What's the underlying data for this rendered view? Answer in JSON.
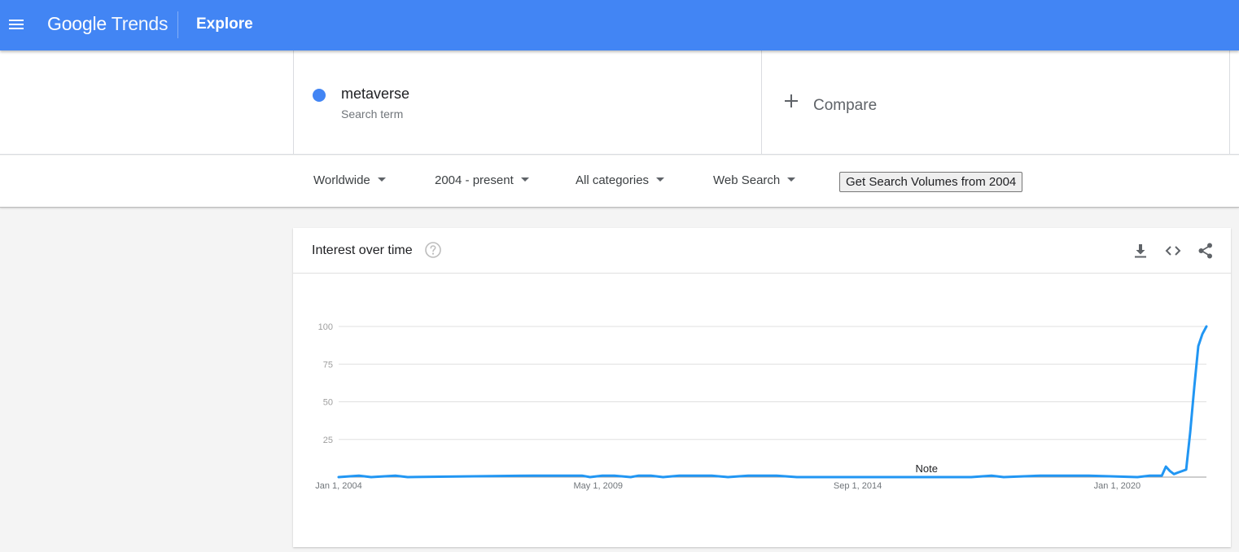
{
  "header": {
    "logo_google": "Google",
    "logo_trends": "Trends",
    "page_title": "Explore"
  },
  "search_term": {
    "name": "metaverse",
    "subtitle": "Search term",
    "color": "#4285f4"
  },
  "compare": {
    "label": "Compare"
  },
  "filters": {
    "region": "Worldwide",
    "time_range": "2004 - present",
    "category": "All categories",
    "search_type": "Web Search",
    "volume_button": "Get Search Volumes from 2004"
  },
  "card": {
    "title": "Interest over time",
    "icons": [
      "help-icon",
      "download-icon",
      "embed-icon",
      "share-icon"
    ]
  },
  "chart_data": {
    "type": "line",
    "title": "",
    "xlabel": "",
    "ylabel": "",
    "ylim": [
      0,
      100
    ],
    "y_ticks": [
      "25",
      "50",
      "75",
      "100"
    ],
    "x_ticks": [
      "Jan 1, 2004",
      "May 1, 2009",
      "Sep 1, 2014",
      "Jan 1, 2020"
    ],
    "annotation": "Note",
    "grid": true,
    "legend": "none",
    "line_color": "#2196f3",
    "series": [
      {
        "name": "metaverse",
        "x": [
          "2004-01",
          "2004-06",
          "2004-09",
          "2005-03",
          "2005-06",
          "2008-01",
          "2008-03",
          "2008-06",
          "2009-01",
          "2009-03",
          "2009-06",
          "2009-09",
          "2010-01",
          "2010-03",
          "2010-06",
          "2010-09",
          "2011-01",
          "2011-03",
          "2011-06",
          "2011-09",
          "2012-01",
          "2012-06",
          "2013-01",
          "2013-06",
          "2017-01",
          "2017-06",
          "2017-09",
          "2018-06",
          "2019-06",
          "2020-06",
          "2020-09",
          "2020-12",
          "2021-01",
          "2021-02",
          "2021-03",
          "2021-04",
          "2021-05",
          "2021-06",
          "2021-07",
          "2021-08",
          "2021-09",
          "2021-10",
          "2021-11"
        ],
        "y": [
          0,
          1,
          0,
          1,
          0,
          1,
          1,
          1,
          1,
          0,
          1,
          1,
          0,
          1,
          1,
          0,
          1,
          1,
          1,
          1,
          0,
          1,
          1,
          0,
          0,
          1,
          0,
          1,
          1,
          0,
          1,
          1,
          7,
          4,
          2,
          3,
          4,
          5,
          30,
          60,
          87,
          95,
          100
        ]
      }
    ]
  }
}
